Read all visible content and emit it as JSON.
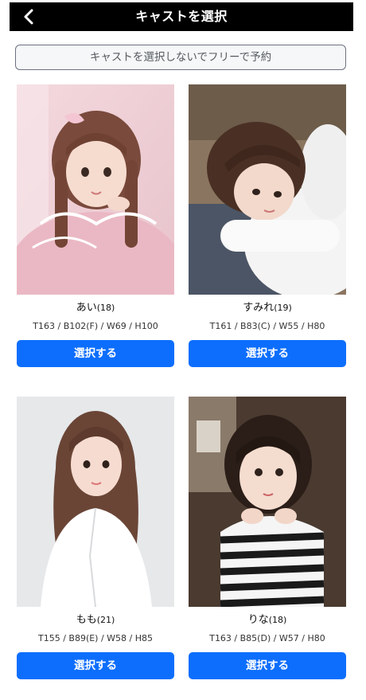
{
  "header": {
    "title": "キャストを選択",
    "back_icon": "chevron-left-icon"
  },
  "free_reservation": {
    "label": "キャストを選択しないでフリーで予約"
  },
  "casts": [
    {
      "name": "あい",
      "age": "(18)",
      "stats": "T163 / B102(F) / W69 / H100",
      "button_label": "選択する"
    },
    {
      "name": "すみれ",
      "age": "(19)",
      "stats": "T161 / B83(C) / W55 / H80",
      "button_label": "選択する"
    },
    {
      "name": "もも",
      "age": "(21)",
      "stats": "T155 / B89(E) / W58 / H85",
      "button_label": "選択する"
    },
    {
      "name": "りな",
      "age": "(18)",
      "stats": "T163 / B85(D) / W57 / H80",
      "button_label": "選択する"
    }
  ],
  "colors": {
    "header_bg": "#000000",
    "button_bg": "#0d6efd",
    "free_button_border": "#6b7280"
  }
}
